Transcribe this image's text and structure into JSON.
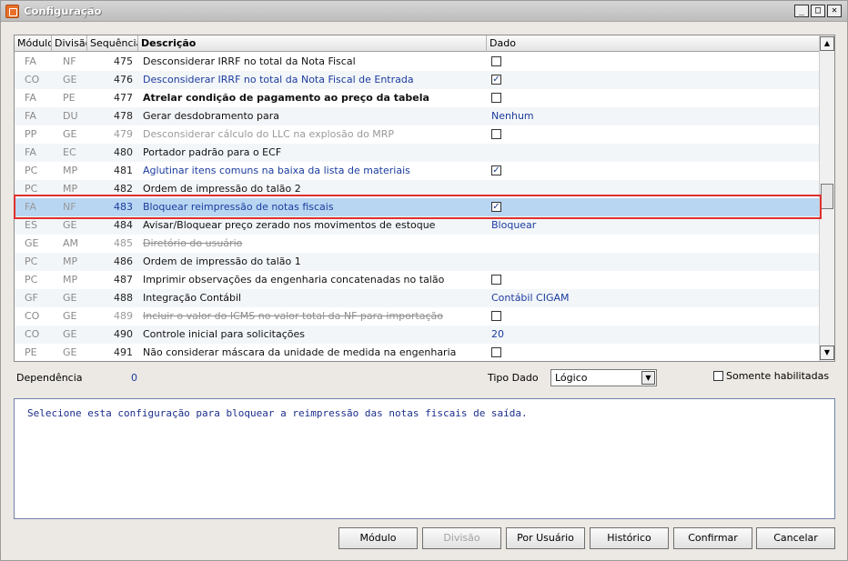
{
  "window": {
    "title": "Configuração",
    "buttons": [
      "_",
      "□",
      "✕"
    ]
  },
  "grid": {
    "columns": [
      "Módulo",
      "Divisão",
      "Sequência",
      "Descrição",
      "Dado"
    ],
    "rows": [
      {
        "mod": "FA",
        "div": "NF",
        "seq": "475",
        "desc": "Desconsiderar IRRF no total da Nota Fiscal",
        "dado_type": "checkbox",
        "checked": false,
        "style": "normal"
      },
      {
        "mod": "CO",
        "div": "GE",
        "seq": "476",
        "desc": "Desconsiderar IRRF no total da Nota Fiscal de Entrada",
        "dado_type": "checkbox",
        "checked": true,
        "style": "blue"
      },
      {
        "mod": "FA",
        "div": "PE",
        "seq": "477",
        "desc": "Atrelar condição de pagamento ao preço da tabela",
        "dado_type": "checkbox",
        "checked": false,
        "style": "bold"
      },
      {
        "mod": "FA",
        "div": "DU",
        "seq": "478",
        "desc": "Gerar desdobramento para",
        "dado_type": "text",
        "dado": "Nenhum",
        "style": "normal"
      },
      {
        "mod": "PP",
        "div": "GE",
        "seq": "479",
        "desc": "Desconsiderar cálculo do LLC na explosão do MRP",
        "dado_type": "checkbox",
        "checked": false,
        "style": "dim"
      },
      {
        "mod": "FA",
        "div": "EC",
        "seq": "480",
        "desc": "Portador padrão para o ECF",
        "dado_type": "none",
        "style": "normal"
      },
      {
        "mod": "PC",
        "div": "MP",
        "seq": "481",
        "desc": "Aglutinar itens comuns na baixa da lista de materiais",
        "dado_type": "checkbox",
        "checked": true,
        "style": "blue"
      },
      {
        "mod": "PC",
        "div": "MP",
        "seq": "482",
        "desc": "Ordem de impressão do talão 2",
        "dado_type": "none",
        "style": "normal"
      },
      {
        "mod": "FA",
        "div": "NF",
        "seq": "483",
        "desc": "Bloquear reimpressão de notas fiscais",
        "dado_type": "checkbox",
        "checked": true,
        "style": "blue",
        "selected": true
      },
      {
        "mod": "ES",
        "div": "GE",
        "seq": "484",
        "desc": "Avisar/Bloquear preço zerado nos movimentos de estoque",
        "dado_type": "text",
        "dado": "Bloquear",
        "style": "normal"
      },
      {
        "mod": "GE",
        "div": "AM",
        "seq": "485",
        "desc": "Diretório do usuário",
        "dado_type": "none",
        "style": "strike"
      },
      {
        "mod": "PC",
        "div": "MP",
        "seq": "486",
        "desc": "Ordem de impressão do talão 1",
        "dado_type": "none",
        "style": "normal"
      },
      {
        "mod": "PC",
        "div": "MP",
        "seq": "487",
        "desc": "Imprimir observações da engenharia concatenadas no talão",
        "dado_type": "checkbox",
        "checked": false,
        "style": "normal"
      },
      {
        "mod": "GF",
        "div": "GE",
        "seq": "488",
        "desc": "Integração Contábil",
        "dado_type": "text",
        "dado": "Contábil CIGAM",
        "style": "normal"
      },
      {
        "mod": "CO",
        "div": "GE",
        "seq": "489",
        "desc": "Incluir o valor do ICMS no valor total da NF para importação",
        "dado_type": "checkbox",
        "checked": false,
        "style": "strike"
      },
      {
        "mod": "CO",
        "div": "GE",
        "seq": "490",
        "desc": "Controle inicial para solicitações",
        "dado_type": "text",
        "dado": "20",
        "style": "normal"
      },
      {
        "mod": "PE",
        "div": "GE",
        "seq": "491",
        "desc": "Não considerar máscara da unidade de medida na engenharia",
        "dado_type": "checkbox",
        "checked": false,
        "style": "normal"
      }
    ]
  },
  "footer": {
    "dependencia_label": "Dependência",
    "dependencia_value": "0",
    "tipo_dado_label": "Tipo Dado",
    "tipo_dado_value": "Lógico",
    "somente_label": "Somente habilitadas"
  },
  "description": "Selecione esta configuração para bloquear a reimpressão das notas fiscais de saída.",
  "buttons": {
    "modulo": "Módulo",
    "divisao": "Divisão",
    "por_usuario": "Por Usuário",
    "historico": "Histórico",
    "confirmar": "Confirmar",
    "cancelar": "Cancelar"
  }
}
